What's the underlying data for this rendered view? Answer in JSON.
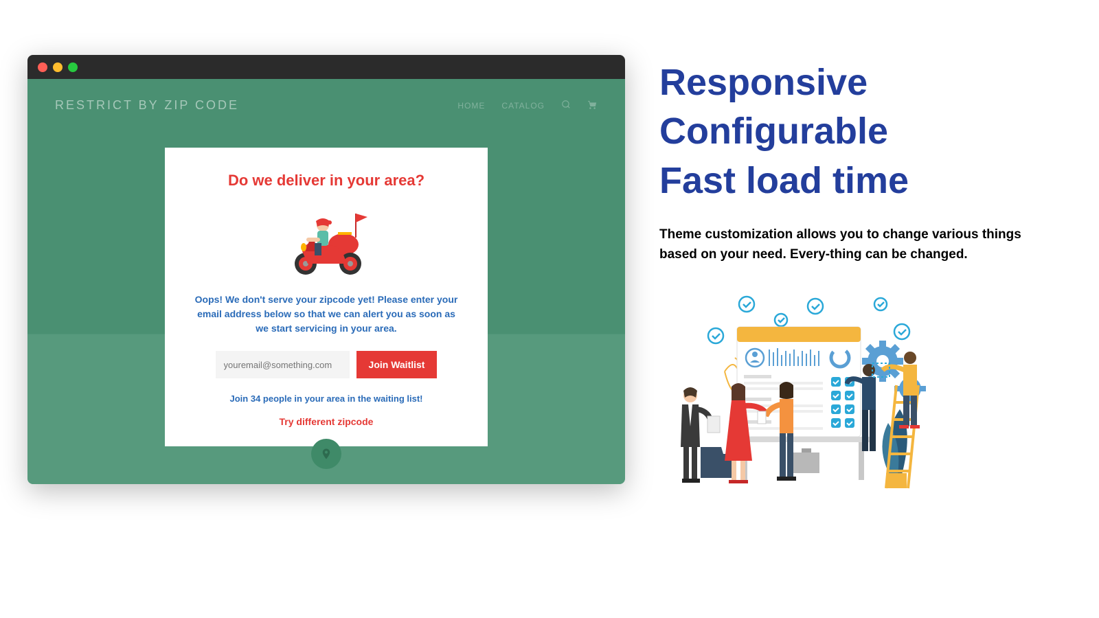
{
  "browser": {
    "nav": {
      "title": "RESTRICT BY ZIP CODE",
      "links": [
        "HOME",
        "CATALOG"
      ]
    },
    "modal": {
      "title": "Do we deliver in your area?",
      "message": "Oops! We don't serve your zipcode yet! Please enter your email address below so that we can alert you as soon as we start servicing in your area.",
      "email_placeholder": "youremail@something.com",
      "join_button": "Join Waitlist",
      "waitlist_text": "Join 34 people in your area in the waiting list!",
      "try_link": "Try different zipcode"
    }
  },
  "right": {
    "heading1": "Responsive",
    "heading2": "Configurable",
    "heading3": "Fast load time",
    "description": "Theme customization allows you to change various things based on your need. Every-thing can be changed."
  }
}
